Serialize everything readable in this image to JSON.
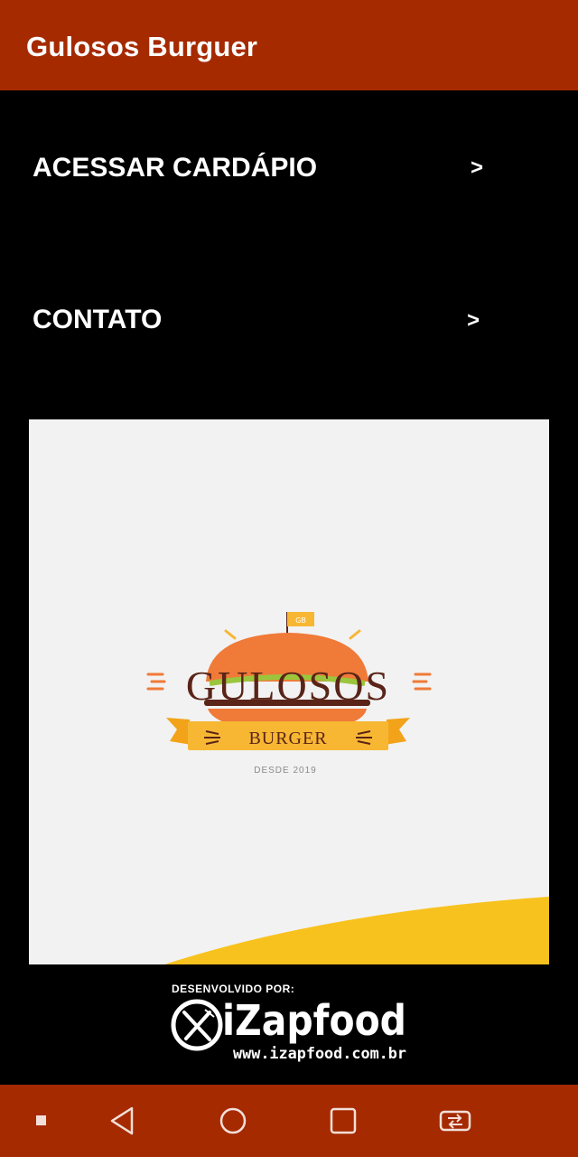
{
  "app_bar": {
    "title": "Gulosos Burguer"
  },
  "menu": {
    "items": [
      {
        "label": "ACESSAR CARDÁPIO",
        "chevron": ">"
      },
      {
        "label": "CONTATO",
        "chevron": ">"
      }
    ]
  },
  "banner": {
    "logo_title": "GULOSOS",
    "logo_ribbon": "BURGER",
    "logo_since": "DESDE 2019",
    "flag_text": "GB"
  },
  "footer": {
    "developed_by": "DESENVOLVIDO POR:",
    "brand": "iZapfood",
    "url": "www.izapfood.com.br"
  },
  "nav": {
    "icons": [
      "small-square-icon",
      "back-icon",
      "home-icon",
      "recents-icon",
      "switch-app-icon"
    ]
  },
  "colors": {
    "app_bar": "#a52a00",
    "background": "#000000",
    "banner": "#f2f2f2",
    "bun": "#f07a38",
    "ribbon": "#f7b733",
    "logo_text": "#5a2418",
    "accent_wave": "#f8c21e"
  }
}
